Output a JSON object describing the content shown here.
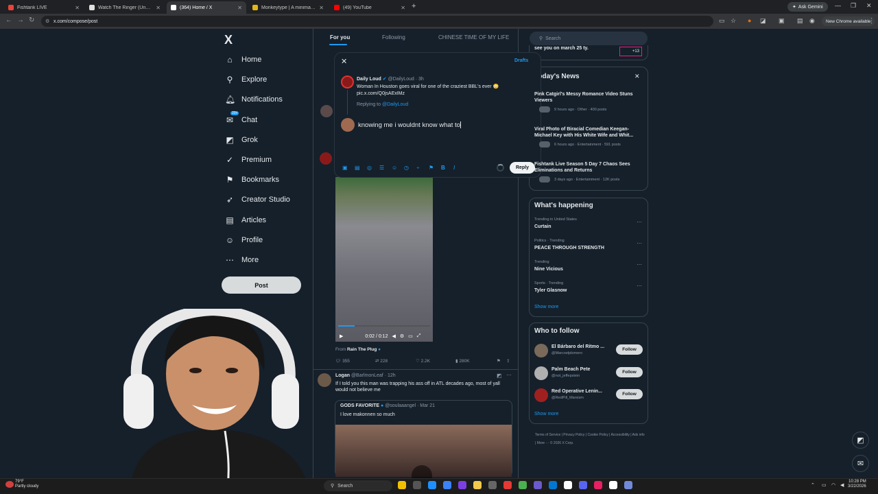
{
  "browser": {
    "tabs": [
      {
        "title": "Fishtank LIVE",
        "color": "#e8443a"
      },
      {
        "title": "Watch The Ringer (Uncut) | Pri",
        "color": "#e0e0e0"
      },
      {
        "title": "(364) Home / X",
        "color": "#ffffff"
      },
      {
        "title": "Monkeytype | A minimalistic, c",
        "color": "#e2b714"
      },
      {
        "title": "(49) YouTube",
        "color": "#ff0000"
      }
    ],
    "ask_gemini": "Ask Gemini",
    "url": "x.com/compose/post",
    "update_label": "New Chrome available"
  },
  "sidebar": {
    "logo": "X",
    "items": [
      {
        "label": "Home",
        "icon": "home-icon",
        "glyph": "⌂"
      },
      {
        "label": "Explore",
        "icon": "search-icon",
        "glyph": "⚲"
      },
      {
        "label": "Notifications",
        "icon": "bell-icon",
        "glyph": "🔔︎"
      },
      {
        "label": "Chat",
        "icon": "chat-icon",
        "glyph": "✉︎"
      },
      {
        "label": "Grok",
        "icon": "grok-icon",
        "glyph": "◩"
      },
      {
        "label": "Premium",
        "icon": "premium-icon",
        "glyph": "✓"
      },
      {
        "label": "Bookmarks",
        "icon": "bookmark-icon",
        "glyph": "⚑"
      },
      {
        "label": "Creator Studio",
        "icon": "rocket-icon",
        "glyph": "➶"
      },
      {
        "label": "Articles",
        "icon": "articles-icon",
        "glyph": "▤"
      },
      {
        "label": "Profile",
        "icon": "profile-icon",
        "glyph": "☺"
      },
      {
        "label": "More",
        "icon": "more-icon",
        "glyph": "⋯"
      }
    ],
    "chat_badge": "20+",
    "post_label": "Post"
  },
  "feed": {
    "tabs": [
      "For you",
      "Following",
      "CHINESE TIME OF MY LIFE"
    ],
    "video_time": "0:02 / 0:12",
    "from_label": "From",
    "from_name": "Rain The Plug",
    "stats": {
      "replies": "355",
      "reposts": "228",
      "likes": "2.2K",
      "views": "280K"
    },
    "logan": {
      "name": "Logan",
      "handle": "@BarlmonLeaf · 12h",
      "text": "If I told you this man was trapping his ass off in ATL decades ago, most of yall would not believe me"
    },
    "quote": {
      "name": "GODS FAVORITE",
      "handle": "@soulaaangel · Mar 21",
      "text": "I love makonnen so much"
    }
  },
  "compose_modal": {
    "drafts": "Drafts",
    "original_name": "Daily Loud",
    "original_handle": "@DailyLoud · 3h",
    "original_text": "Woman In Houston goes viral for one of the craziest BBL's ever 😳 pic.x.com/Q0jsAExIMz",
    "replying_prefix": "Replying to",
    "replying_to": "@DailyLoud",
    "draft_text": "knowing me i wouldnt know what to",
    "reply_label": "Reply"
  },
  "right": {
    "search_placeholder": "Search",
    "top_snippet": "see you on march 25 ty.",
    "top_count": "+13",
    "news_title": "Today's News",
    "news": [
      {
        "title": "Pink Catgirl's Messy Romance Video Stuns Viewers",
        "meta": "9 hours ago · Other · 400 posts"
      },
      {
        "title": "Viral Photo of Biracial Comedian Keegan-Michael Key with His White Wife and Whit...",
        "meta": "6 hours ago · Entertainment · 591 posts"
      },
      {
        "title": "Fishtank Live Season 5 Day 7 Chaos Sees Eliminations and Returns",
        "meta": "3 days ago · Entertainment · 12K posts"
      }
    ],
    "happening_title": "What's happening",
    "trends": [
      {
        "context": "Trending in United States",
        "name": "Curtain"
      },
      {
        "context": "Politics · Trending",
        "name": "PEACE THROUGH STRENGTH"
      },
      {
        "context": "Trending",
        "name": "Nine Vicious"
      },
      {
        "context": "Sports · Trending",
        "name": "Tyler Glasnow"
      }
    ],
    "show_more": "Show more",
    "follow_title": "Who to follow",
    "follows": [
      {
        "name": "El Bárbaro del Ritmo ...",
        "handle": "@Marcoelplomero"
      },
      {
        "name": "Palm Beach Pete",
        "handle": "@not_jeffepstein"
      },
      {
        "name": "Red Operative Lenin...",
        "handle": "@RedPill_Marxism"
      }
    ],
    "follow_label": "Follow",
    "footer": "Terms of Service | Privacy Policy | Cookie Policy | Accessibility | Ads info | More ··· © 2026 X Corp."
  },
  "taskbar": {
    "temp": "79°F",
    "weather": "Partly cloudy",
    "search": "Search",
    "time": "10:28 PM",
    "date": "3/22/2026"
  }
}
